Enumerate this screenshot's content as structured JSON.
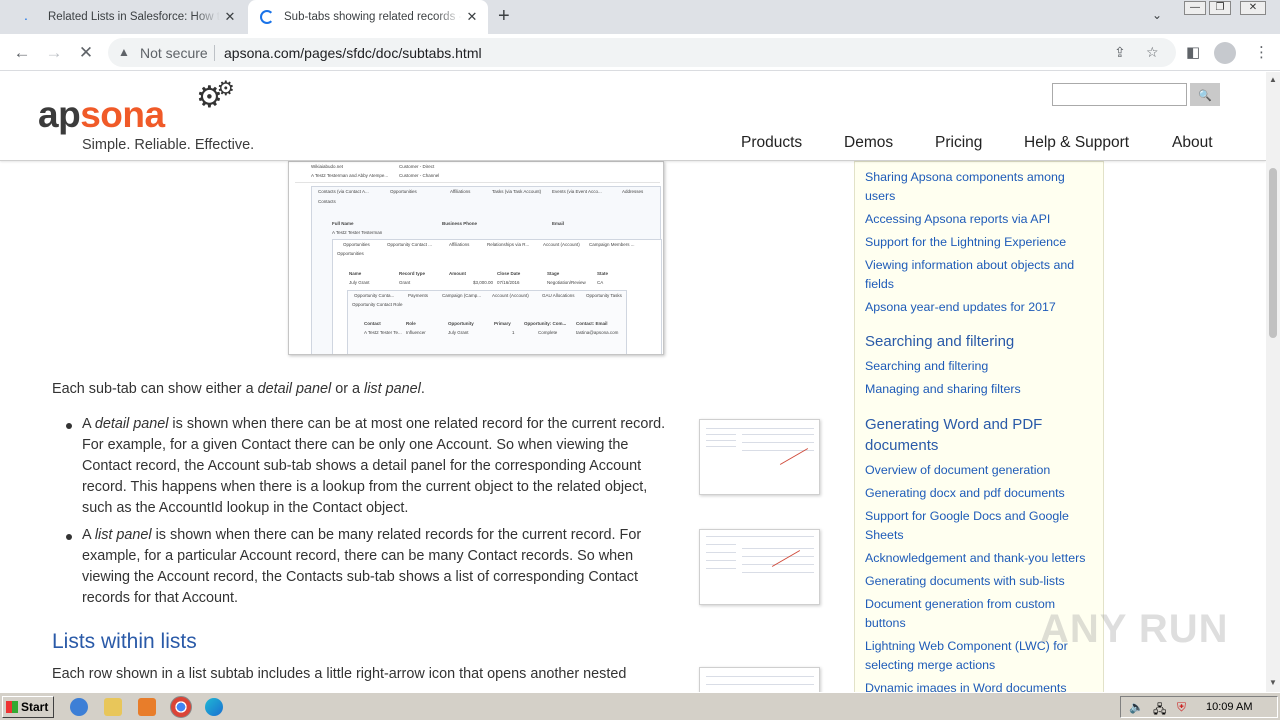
{
  "browser": {
    "tabs": [
      {
        "title": "Related Lists in Salesforce: How to S",
        "active": false
      },
      {
        "title": "Sub-tabs showing related records - A",
        "active": true
      }
    ],
    "new_tab": "+",
    "security_label": "Not secure",
    "url": "apsona.com/pages/sfdc/doc/subtabs.html"
  },
  "site": {
    "logo_part1": "ap",
    "logo_part2": "sona",
    "tagline": "Simple. Reliable. Effective.",
    "search_button": "🔍",
    "nav": [
      "Products",
      "Demos",
      "Pricing",
      "Help & Support",
      "About"
    ]
  },
  "main": {
    "intro": "Each sub-tab can show either a detail panel or a list panel.",
    "intro_parts": [
      "Each sub-tab can show either a ",
      "detail panel",
      " or a ",
      "list panel",
      "."
    ],
    "bullets": [
      {
        "lead": "A ",
        "term": "detail panel",
        "text": " is shown when there can be at most one related record for the current record. For example, for a given Contact there can be only one Account. So when viewing the Contact record, the Account sub-tab shows a detail panel for the corresponding Account record. This happens when there is a lookup from the current object to the related object, such as the AccountId lookup in the Contact object."
      },
      {
        "lead": "A ",
        "term": "list panel",
        "text": " is shown when there can be many related records for the current record. For example, for a particular Account record, there can be many Contact records. So when viewing the Account record, the Contacts sub-tab shows a list of corresponding Contact records for that Account."
      }
    ],
    "section_title": "Lists within lists",
    "section_text": "Each row shown in a list subtab includes a little right-arrow icon that opens another nested"
  },
  "sidebar": {
    "groups": [
      {
        "links": [
          "Sharing Apsona components among users",
          "Accessing Apsona reports via API",
          "Support for the Lightning Experience",
          "Viewing information about objects and fields",
          "Apsona year-end updates for 2017"
        ]
      },
      {
        "heading": "Searching and filtering",
        "links": [
          "Searching and filtering",
          "Managing and sharing filters"
        ]
      },
      {
        "heading": "Generating Word and PDF documents",
        "links": [
          "Overview of document generation",
          "Generating docx and pdf documents",
          "Support for Google Docs and Google Sheets",
          "Acknowledgement and thank-you letters",
          "Generating documents with sub-lists",
          "Document generation from custom buttons",
          "Lightning Web Component (LWC) for selecting merge actions",
          "Dynamic images in Word documents"
        ]
      }
    ]
  },
  "screenshot_text": {
    "row1": "Wikiaiabudo.net",
    "row1b": "Customer - Direct",
    "row2": "A Test2 Testerman and Abby Atempe...",
    "row2b": "Customer - Channel",
    "tabs1": [
      "Contacts (via Contact A...",
      "Opportunities",
      "Affiliations",
      "Tasks (via Task Account)",
      "Events (via Event Acco...",
      "Addresses"
    ],
    "contacts": "Contacts",
    "full_name": "Full Name",
    "business_phone": "Business Phone",
    "email": "Email",
    "contact_row": "A Test2 Tester Testerman",
    "tabs2": [
      "Opportunities",
      "Opportunity Contact ...",
      "Affiliations",
      "Relationships via R...",
      "Account (Account)",
      "Campaign Members ..."
    ],
    "opps": "Opportunities",
    "opp_cols": [
      "Name",
      "Record type",
      "Amount",
      "Close Date",
      "Stage",
      "State"
    ],
    "opp_row": [
      "July Grant",
      "Grant",
      "$3,000.00",
      "07/16/2016",
      "Negotiation/Review",
      "CA"
    ],
    "tabs3": [
      "Opportunity Conta...",
      "Payments",
      "Campaign (Camp...",
      "Account (Account)",
      "GAU Allocations",
      "Opportunity Tasks"
    ],
    "ocr": "Opportunity Contact Role",
    "ocr_cols": [
      "Contact",
      "Role",
      "Opportunity",
      "Primary",
      "Opportunity: Com...",
      "Contact: Email"
    ],
    "ocr_row": [
      "A Test2 Tester Te...",
      "Influencer",
      "July Grant",
      "1",
      "Complete",
      "tastina@apsona.com"
    ]
  },
  "watermark": "ANY RUN",
  "taskbar": {
    "start": "Start",
    "time": "10:09 AM"
  }
}
